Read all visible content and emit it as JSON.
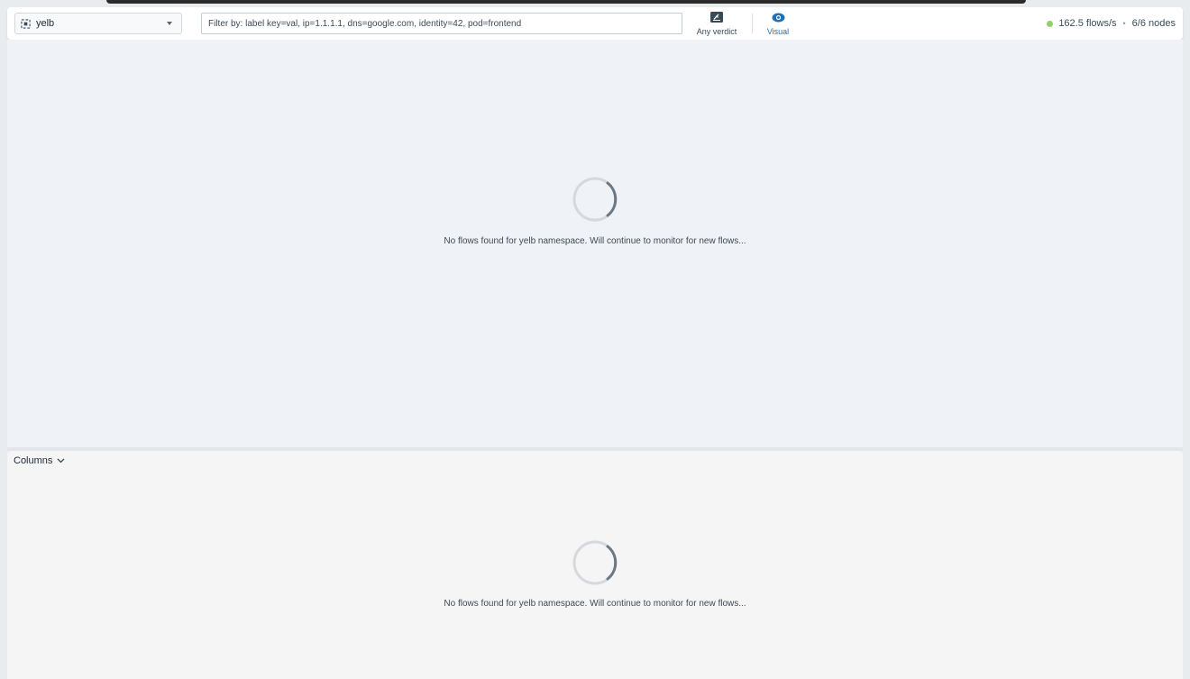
{
  "namespace_selector": {
    "value": "yelb",
    "icon": "namespace-icon"
  },
  "filter": {
    "placeholder": "Filter by: label key=val, ip=1.1.1.1, dns=google.com, identity=42, pod=frontend",
    "value": ""
  },
  "toolbar": {
    "verdict_label": "Any verdict",
    "visual_label": "Visual"
  },
  "status": {
    "flows_rate": "162.5 flows/s",
    "separator": "•",
    "nodes": "6/6 nodes",
    "indicator_color": "#8fd16a"
  },
  "map_panel": {
    "empty_message": "No flows found for yelb namespace. Will continue to monitor for new flows..."
  },
  "flows_panel": {
    "columns_label": "Columns",
    "empty_message": "No flows found for yelb namespace. Will continue to monitor for new flows..."
  },
  "colors": {
    "accent": "#1f6fb2",
    "map_background": "#eff2f6",
    "flows_background": "#f5f5f6"
  }
}
